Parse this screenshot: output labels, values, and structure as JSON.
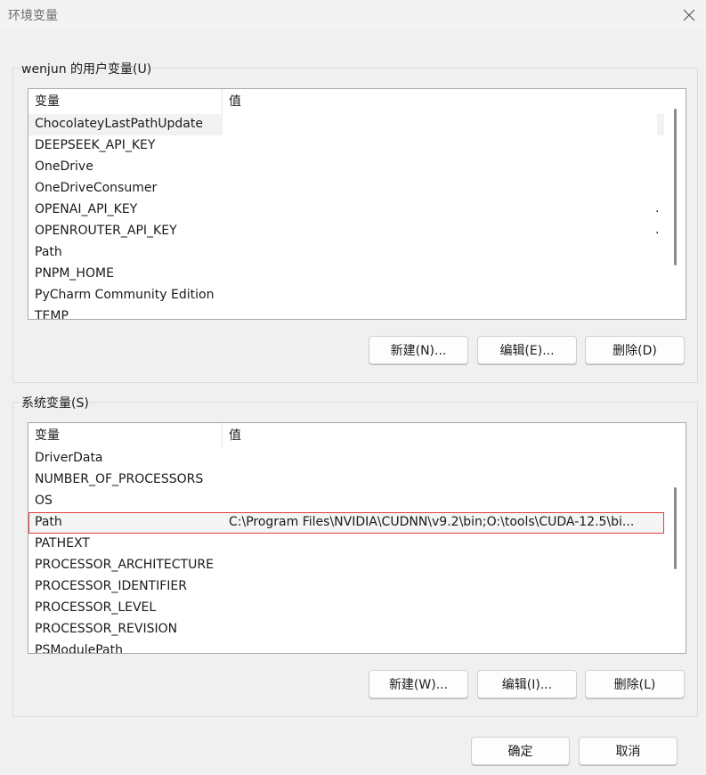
{
  "window": {
    "title": "环境变量"
  },
  "user_vars": {
    "label": "wenjun 的用户变量(U)",
    "columns": [
      "变量",
      "值"
    ],
    "rows": [
      {
        "name": "ChocolateyLastPathUpdate",
        "value": ""
      },
      {
        "name": "DEEPSEEK_API_KEY",
        "value": ""
      },
      {
        "name": "OneDrive",
        "value": ""
      },
      {
        "name": "OneDriveConsumer",
        "value": ""
      },
      {
        "name": "OPENAI_API_KEY",
        "value": ""
      },
      {
        "name": "OPENROUTER_API_KEY",
        "value": ""
      },
      {
        "name": "Path",
        "value": ""
      },
      {
        "name": "PNPM_HOME",
        "value": ""
      },
      {
        "name": "PyCharm Community Edition",
        "value": ""
      },
      {
        "name": "TEMP",
        "value": ""
      }
    ],
    "new_label": "新建(N)...",
    "edit_label": "编辑(E)...",
    "delete_label": "删除(D)"
  },
  "system_vars": {
    "label": "系统变量(S)",
    "columns": [
      "变量",
      "值"
    ],
    "rows": [
      {
        "name": "DriverData",
        "value": ""
      },
      {
        "name": "NUMBER_OF_PROCESSORS",
        "value": ""
      },
      {
        "name": "OS",
        "value": ""
      },
      {
        "name": "Path",
        "value": "C:\\Program Files\\NVIDIA\\CUDNN\\v9.2\\bin;O:\\tools\\CUDA-12.5\\bi..."
      },
      {
        "name": "PATHEXT",
        "value": ""
      },
      {
        "name": "PROCESSOR_ARCHITECTURE",
        "value": ""
      },
      {
        "name": "PROCESSOR_IDENTIFIER",
        "value": ""
      },
      {
        "name": "PROCESSOR_LEVEL",
        "value": ""
      },
      {
        "name": "PROCESSOR_REVISION",
        "value": ""
      },
      {
        "name": "PSModulePath",
        "value": ""
      }
    ],
    "new_label": "新建(W)...",
    "edit_label": "编辑(I)...",
    "delete_label": "删除(L)"
  },
  "footer": {
    "ok_label": "确定",
    "cancel_label": "取消"
  },
  "icons": {
    "close": "close-icon"
  }
}
